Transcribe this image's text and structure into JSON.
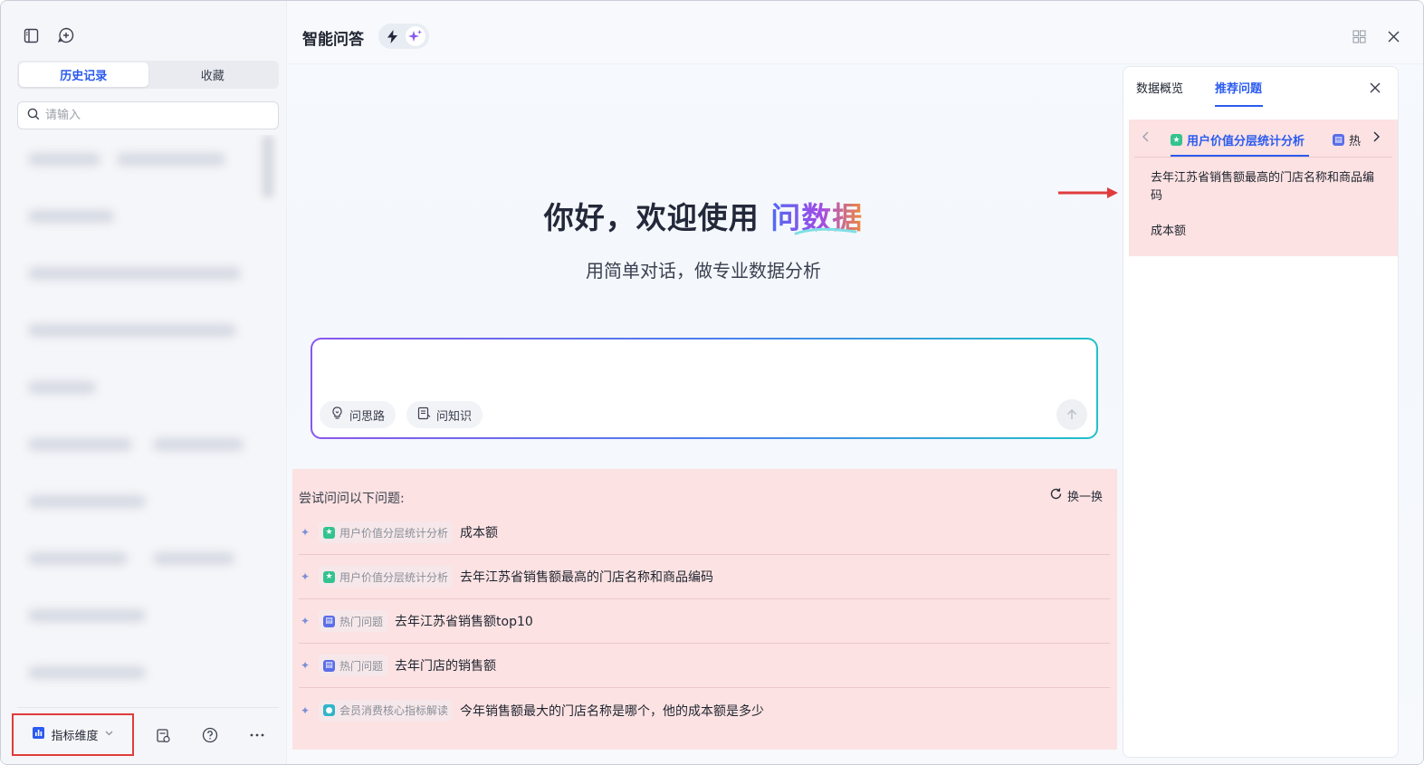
{
  "sidebar": {
    "tabs": [
      {
        "label": "历史记录",
        "active": true
      },
      {
        "label": "收藏",
        "active": false
      }
    ],
    "search": {
      "placeholder": "请输入",
      "value": ""
    },
    "footer": {
      "metric_label": "指标维度"
    }
  },
  "header": {
    "title": "智能问答"
  },
  "main": {
    "welcome_prefix": "你好，欢迎使用 ",
    "welcome_brand": "问数据",
    "subtitle": "用简单对话，做专业数据分析",
    "input": {
      "value": "",
      "placeholder": ""
    },
    "chips": [
      {
        "label": "问思路",
        "icon": "bulb-icon"
      },
      {
        "label": "问知识",
        "icon": "doc-icon"
      }
    ],
    "suggestions": {
      "title": "尝试问问以下问题:",
      "refresh_label": "换一换",
      "items": [
        {
          "tag": "用户价值分层统计分析",
          "tag_color": "#34c38f",
          "text": "成本额"
        },
        {
          "tag": "用户价值分层统计分析",
          "tag_color": "#34c38f",
          "text": "去年江苏省销售额最高的门店名称和商品编码"
        },
        {
          "tag": "热门问题",
          "tag_color": "#5b6ee8",
          "text": "去年江苏省销售额top10"
        },
        {
          "tag": "热门问题",
          "tag_color": "#5b6ee8",
          "text": "去年门店的销售额"
        },
        {
          "tag": "会员消费核心指标解读",
          "tag_color": "#2fb5c9",
          "text": "今年销售额最大的门店名称是哪个，他的成本额是多少"
        }
      ]
    }
  },
  "right_panel": {
    "tabs": [
      {
        "label": "数据概览",
        "active": false
      },
      {
        "label": "推荐问题",
        "active": true
      }
    ],
    "carousel": [
      {
        "label": "用户价值分层统计分析",
        "active": true,
        "color": "#34c38f"
      },
      {
        "label": "热",
        "active": false,
        "color": "#5b6ee8"
      }
    ],
    "questions": [
      "去年江苏省销售额最高的门店名称和商品编码",
      "成本额"
    ]
  },
  "colors": {
    "accent": "#2b5bf0",
    "highlight": "#fce2e2",
    "annotation_red": "#e03c3c"
  }
}
